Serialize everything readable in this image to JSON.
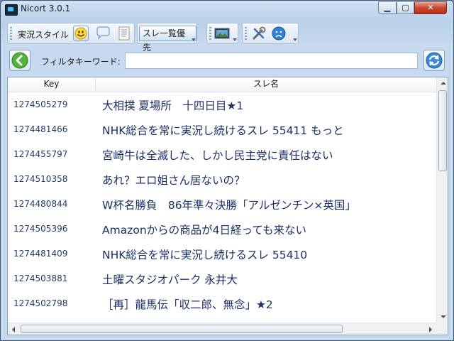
{
  "window": {
    "title": "Nicort 3.0.1",
    "minimize_glyph": "▁",
    "maximize_glyph": "▢",
    "close_glyph": "✕"
  },
  "toolbar": {
    "mode_label": "実況スタイル",
    "thread_priority_label": "スレ一覧優先",
    "icons": [
      "smiley-icon",
      "speech-bubble-icon",
      "document-icon",
      "image-icon",
      "settings-tools-icon",
      "sad-face-icon"
    ]
  },
  "filter": {
    "label": "フィルタキーワード:",
    "value": "",
    "placeholder": ""
  },
  "table": {
    "columns": {
      "key": "Key",
      "name": "スレ名"
    },
    "rows": [
      {
        "key": "1274505279",
        "name": "大相撲 夏場所　十四日目★1"
      },
      {
        "key": "1274481466",
        "name": "NHK総合を常に実況し続けるスレ 55411 もっと"
      },
      {
        "key": "1274455797",
        "name": "宮崎牛は全滅した、しかし民主党に責任はない"
      },
      {
        "key": "1274510358",
        "name": "あれ？エロ姐さん居ないの？"
      },
      {
        "key": "1274480844",
        "name": "W杯名勝負　86年準々決勝「アルゼンチン×英国」"
      },
      {
        "key": "1274505396",
        "name": "Amazonからの商品が4日経っても来ない"
      },
      {
        "key": "1274481409",
        "name": "NHK総合を常に実況し続けるスレ 55410"
      },
      {
        "key": "1274503881",
        "name": "土曜スタジオパーク 永井大"
      },
      {
        "key": "1274502798",
        "name": "［再］龍馬伝「収二郎、無念」★2"
      }
    ]
  },
  "colors": {
    "accent": "#7da2ce",
    "row_text": "#1a2f66",
    "key_text": "#1f3a5f"
  }
}
